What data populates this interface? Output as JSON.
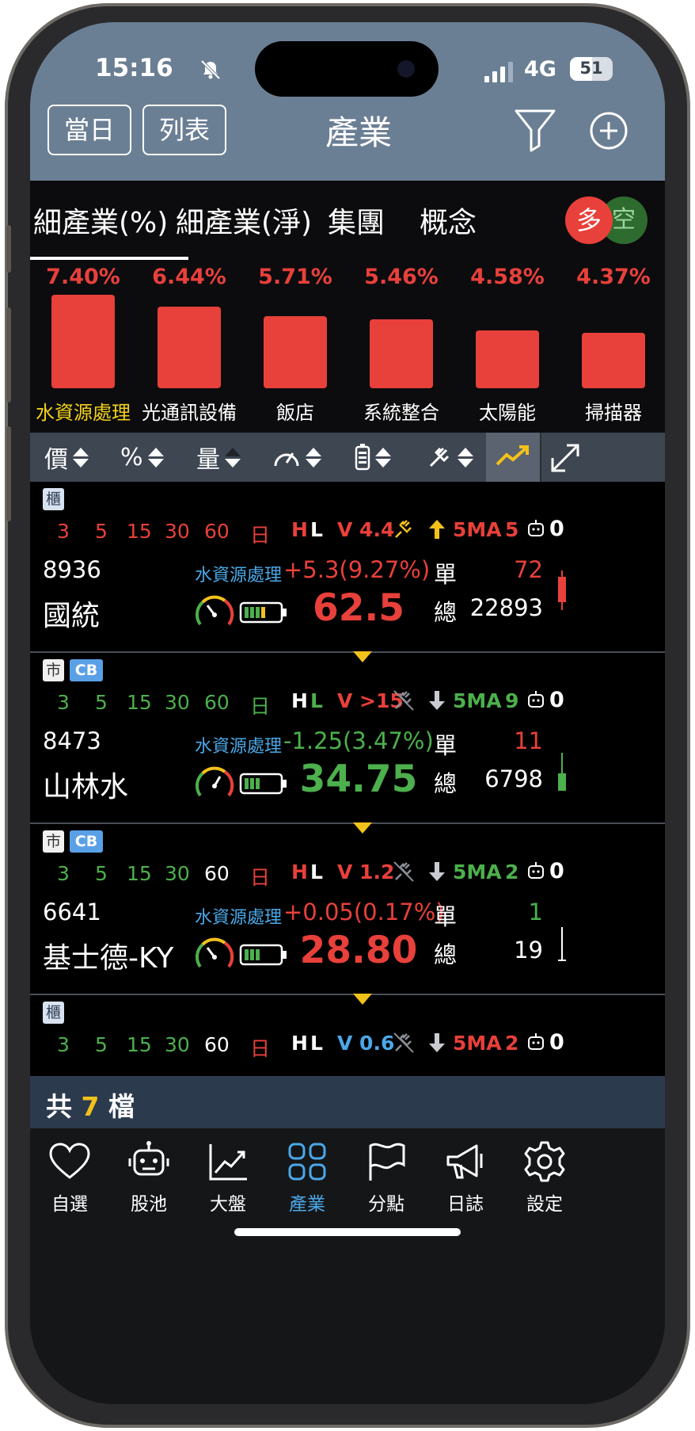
{
  "status": {
    "time": "15:16",
    "network": "4G",
    "battery": "51"
  },
  "header": {
    "btn_day": "當日",
    "btn_list": "列表",
    "title": "產業"
  },
  "tabs": [
    {
      "label": "細產業(%)"
    },
    {
      "label": "細產業(淨)"
    },
    {
      "label": "集團"
    },
    {
      "label": "概念"
    }
  ],
  "toggle": {
    "long": "多",
    "short": "空"
  },
  "chart_data": {
    "type": "bar",
    "categories": [
      "水資源處理",
      "光通訊設備",
      "飯店",
      "系統整合",
      "太陽能",
      "掃描器"
    ],
    "values": [
      7.4,
      6.44,
      5.71,
      5.46,
      4.58,
      4.37
    ],
    "value_labels": [
      "7.40%",
      "6.44%",
      "5.71%",
      "5.46%",
      "4.58%",
      "4.37%"
    ],
    "ylim": [
      0,
      7.4
    ],
    "bar_color": "#e8403a",
    "highlighted_category": "水資源處理"
  },
  "sortbar": {
    "price": "價",
    "pct": "%",
    "vol": "量"
  },
  "rows": [
    {
      "badge": "櫃",
      "cb": "",
      "periods": [
        "3",
        "5",
        "15",
        "30",
        "60",
        "日"
      ],
      "period_colors": [
        "red",
        "red",
        "red",
        "red",
        "red",
        "red"
      ],
      "h": "H",
      "l": "L",
      "h_color": "red",
      "l_color": "white",
      "v": "V 4.4",
      "v_color": "red",
      "arrow": "up",
      "ma": "5MA",
      "ma_color": "red",
      "ma_count": "5",
      "robot": "0",
      "code": "8936",
      "industry": "水資源處理",
      "change": "+5.3(9.27%)",
      "change_color": "red",
      "dan_label": "單",
      "dan": "72",
      "dan_color": "red",
      "name": "國統",
      "price": "62.5",
      "price_color": "red",
      "zong_label": "總",
      "zong": "22893"
    },
    {
      "badge": "市",
      "cb": "CB",
      "periods": [
        "3",
        "5",
        "15",
        "30",
        "60",
        "日"
      ],
      "period_colors": [
        "green",
        "green",
        "green",
        "green",
        "green",
        "green"
      ],
      "h": "H",
      "l": "L",
      "h_color": "white",
      "l_color": "green",
      "v": "V >15",
      "v_color": "red",
      "arrow": "down",
      "ma": "5MA",
      "ma_color": "green",
      "ma_count": "9",
      "robot": "0",
      "code": "8473",
      "industry": "水資源處理",
      "change": "-1.25(3.47%)",
      "change_color": "green",
      "dan_label": "單",
      "dan": "11",
      "dan_color": "red",
      "name": "山林水",
      "price": "34.75",
      "price_color": "green",
      "zong_label": "總",
      "zong": "6798"
    },
    {
      "badge": "市",
      "cb": "CB",
      "periods": [
        "3",
        "5",
        "15",
        "30",
        "60",
        "日"
      ],
      "period_colors": [
        "green",
        "green",
        "green",
        "green",
        "white",
        "red"
      ],
      "h": "H",
      "l": "L",
      "h_color": "red",
      "l_color": "white",
      "v": "V 1.2",
      "v_color": "red",
      "arrow": "down",
      "ma": "5MA",
      "ma_color": "green",
      "ma_count": "2",
      "robot": "0",
      "code": "6641",
      "industry": "水資源處理",
      "change": "+0.05(0.17%)",
      "change_color": "red",
      "dan_label": "單",
      "dan": "1",
      "dan_color": "green",
      "name": "基士德-KY",
      "price": "28.80",
      "price_color": "red",
      "zong_label": "總",
      "zong": "19"
    },
    {
      "badge": "櫃",
      "cb": "",
      "periods": [
        "3",
        "5",
        "15",
        "30",
        "60",
        "日"
      ],
      "period_colors": [
        "green",
        "green",
        "green",
        "green",
        "white",
        "red"
      ],
      "h": "H",
      "l": "L",
      "h_color": "white",
      "l_color": "white",
      "v": "V 0.6",
      "v_color": "blue",
      "arrow": "down",
      "ma": "5MA",
      "ma_color": "red",
      "ma_count": "2",
      "robot": "0"
    }
  ],
  "count": {
    "prefix": "共",
    "num": "7",
    "suffix": "檔"
  },
  "nav": [
    {
      "label": "自選",
      "icon": "heart-icon"
    },
    {
      "label": "股池",
      "icon": "robot-icon"
    },
    {
      "label": "大盤",
      "icon": "chart-line-icon"
    },
    {
      "label": "產業",
      "icon": "grid-icon"
    },
    {
      "label": "分點",
      "icon": "flag-icon"
    },
    {
      "label": "日誌",
      "icon": "megaphone-icon"
    },
    {
      "label": "設定",
      "icon": "gear-icon"
    }
  ],
  "colors": {
    "up": "#e8403a",
    "down": "#4cb04c",
    "accent": "#4aa8e8",
    "highlight": "#f2d11b"
  }
}
